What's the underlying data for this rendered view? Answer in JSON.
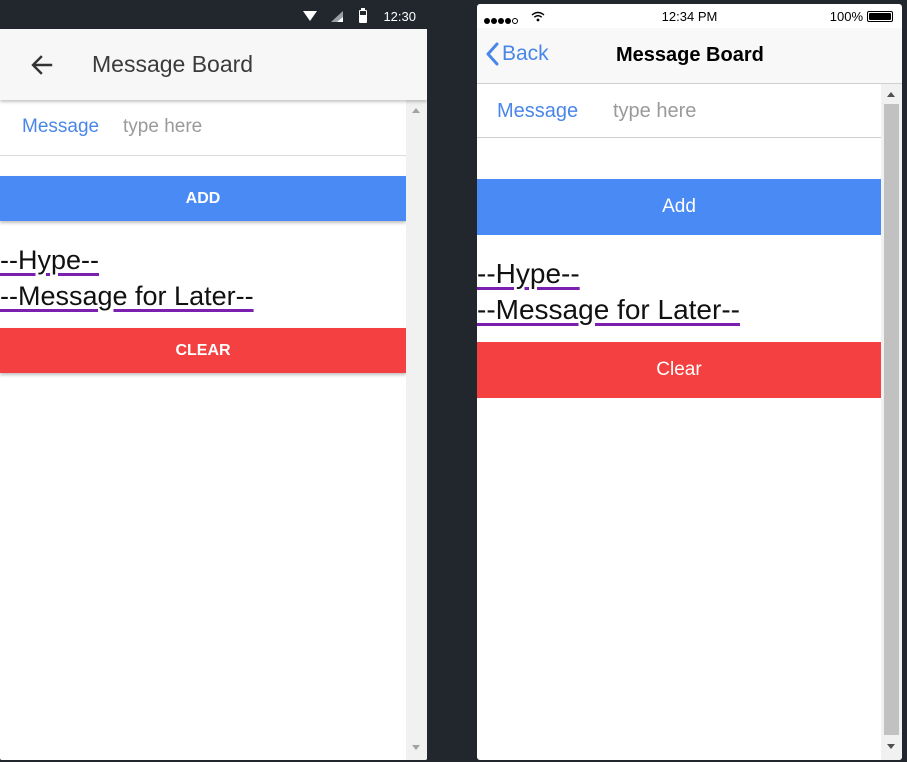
{
  "android": {
    "status_bar": {
      "time": "12:30"
    },
    "header": {
      "title": "Message Board"
    },
    "form": {
      "label": "Message",
      "placeholder": "type here",
      "value": ""
    },
    "buttons": {
      "add": "ADD",
      "clear": "CLEAR"
    },
    "messages": [
      "--Hype--",
      "--Message for Later--"
    ]
  },
  "ios": {
    "status_bar": {
      "time": "12:34 PM",
      "battery": "100%"
    },
    "nav": {
      "back": "Back",
      "title": "Message Board"
    },
    "form": {
      "label": "Message",
      "placeholder": "type here",
      "value": ""
    },
    "buttons": {
      "add": "Add",
      "clear": "Clear"
    },
    "messages": [
      "--Hype--",
      "--Message for Later--"
    ]
  },
  "colors": {
    "accent_blue": "#4a8af4",
    "label_blue": "#4a86e8",
    "clear_red": "#f44040",
    "link_underline": "#7a1fb0",
    "background": "#22272e"
  }
}
